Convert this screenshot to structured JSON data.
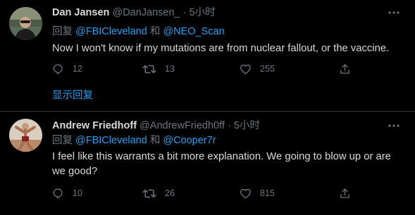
{
  "tweets": [
    {
      "name": "Dan Jansen",
      "handle": "@DanJansen_",
      "sep": "·",
      "time": "5小时",
      "reply_prefix": "回复",
      "mention1": "@FBICleveland",
      "and": "和",
      "mention2": "@NEO_Scan",
      "text": "Now I won't know if my mutations are from nuclear fallout, or the vaccine.",
      "replies": "12",
      "retweets": "13",
      "likes": "255"
    },
    {
      "name": "Andrew Friedhoff",
      "handle": "@AndrewFriedh0ff",
      "sep": "·",
      "time": "5小时",
      "reply_prefix": "回复",
      "mention1": "@FBICleveland",
      "and": "和",
      "mention2": "@Cooper7r",
      "text": "I feel like this warrants a bit more explanation. We going to blow up or are we good?",
      "replies": "10",
      "retweets": "26",
      "likes": "815"
    }
  ],
  "show_replies_label": "显示回复",
  "colors": {
    "background": "#000000",
    "text": "#d9d9d9",
    "secondary": "#6e767d",
    "accent": "#1da1f2",
    "divider": "#2f3336"
  },
  "icons": [
    "more-icon",
    "reply-icon",
    "retweet-icon",
    "like-icon",
    "share-icon"
  ]
}
